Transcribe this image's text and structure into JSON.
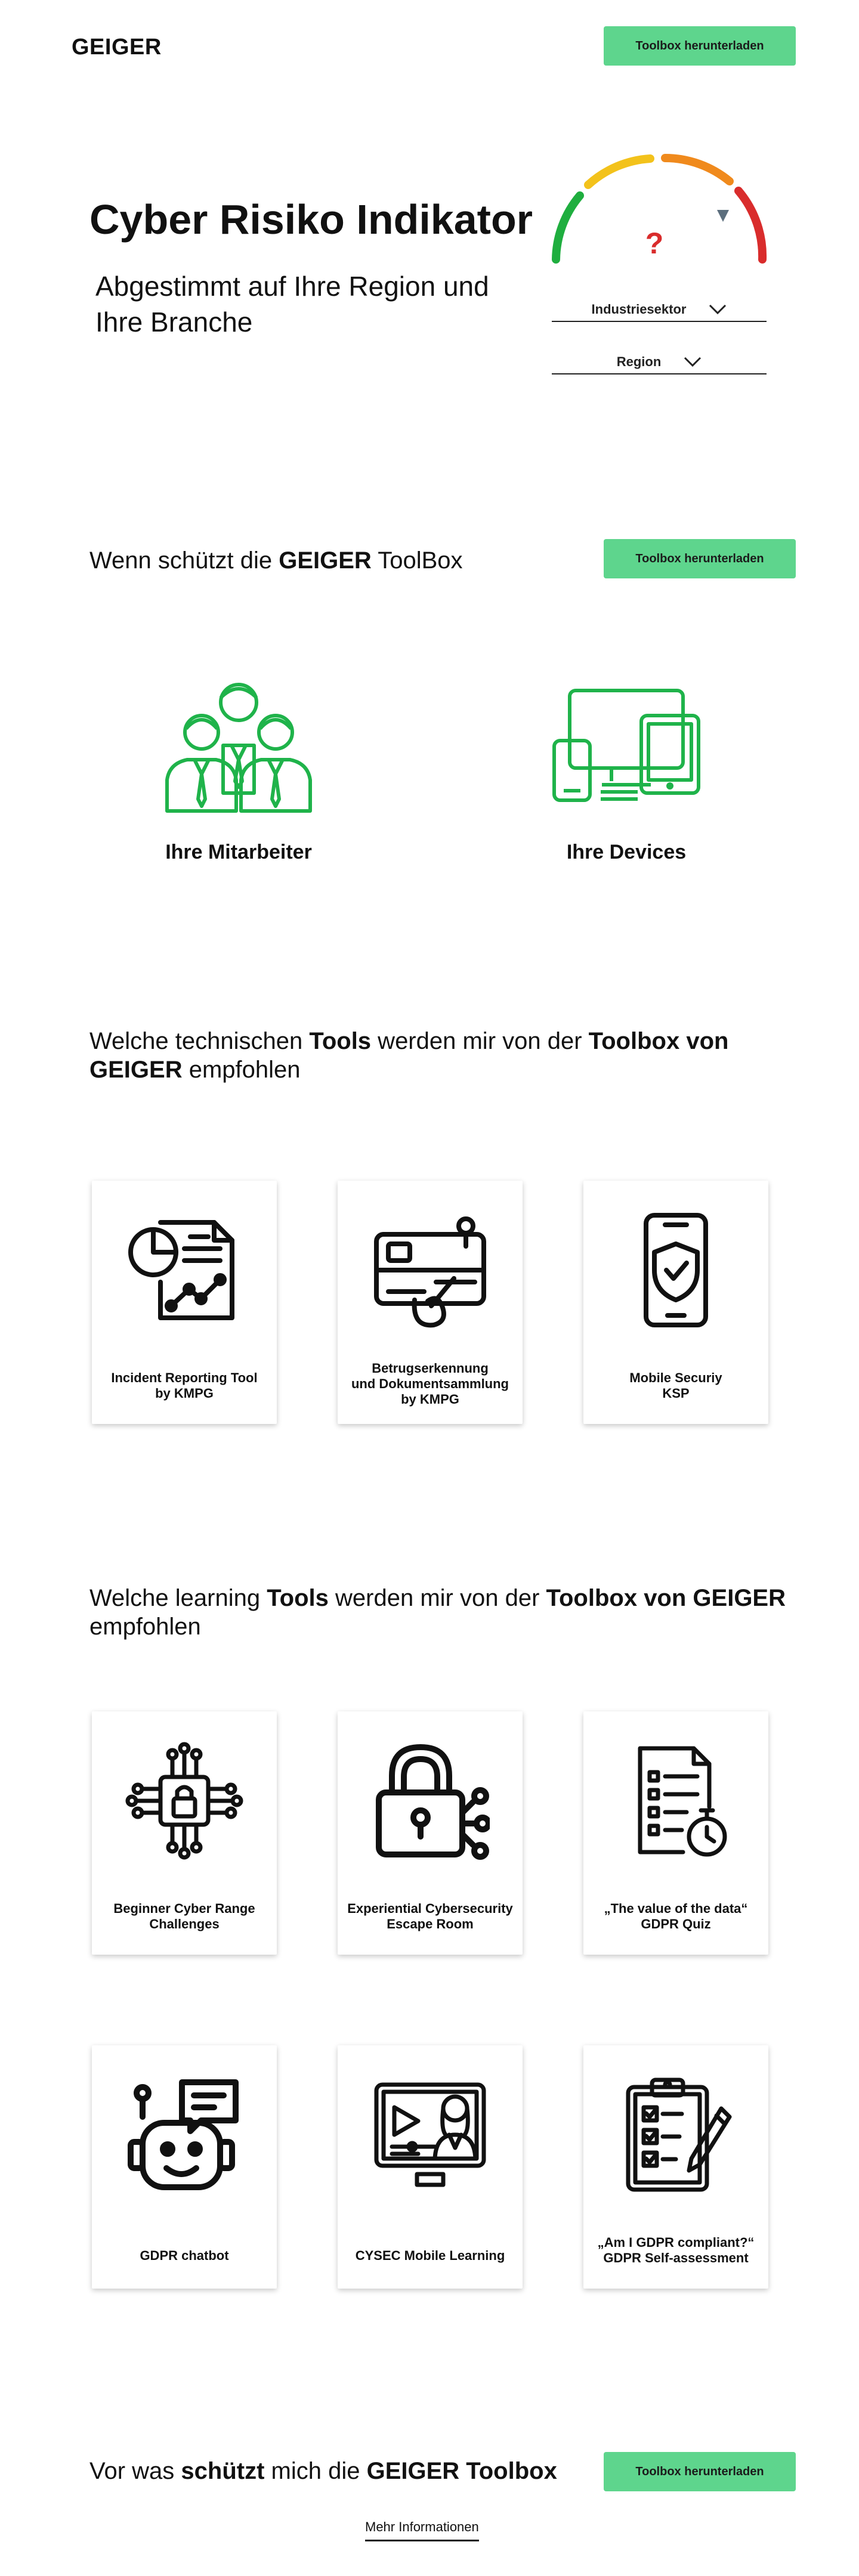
{
  "header": {
    "logo": "GEIGER",
    "cta_label": "Toolbox herunterladen"
  },
  "hero": {
    "title": "Cyber Risiko Indikator",
    "subtitle": "Abgestimmt auf Ihre Region und Ihre Branche",
    "gauge_value": "?",
    "gauge_colors": [
      "#1fae3f",
      "#f3c21b",
      "#f08a1d",
      "#d92c2c"
    ],
    "industry_label": "Industriesektor",
    "region_label": "Region"
  },
  "protects": {
    "text_pre": "Wenn schützt die ",
    "text_bold": "GEIGER",
    "text_post": " ToolBox",
    "cta_label": "Toolbox herunterladen",
    "features": [
      {
        "label": "Ihre Mitarbeiter",
        "icon": "employees-icon"
      },
      {
        "label": "Ihre Devices",
        "icon": "devices-icon"
      }
    ],
    "accent": "#1fb34a"
  },
  "technical": {
    "t1": "Welche technischen ",
    "b1": "Tools",
    "t2": " werden mir von der ",
    "b2": "Toolbox von",
    "b3": "GEIGER",
    "t3": " empfohlen",
    "cards": [
      {
        "label": "Incident Reporting Tool\nby KMPG",
        "icon": "report-chart-icon"
      },
      {
        "label": "Betrugserkennung\nund Dokumentsammlung\nby KMPG",
        "icon": "credit-card-fraud-icon"
      },
      {
        "label": "Mobile Securiy\nKSP",
        "icon": "mobile-shield-icon"
      }
    ]
  },
  "learning": {
    "t1": "Welche learning ",
    "b1": "Tools",
    "t2": " werden mir von der ",
    "b2": "Toolbox von GEIGER",
    "t3": "empfohlen",
    "cards": [
      {
        "label": "Beginner Cyber Range\nChallenges",
        "icon": "circuit-lock-icon"
      },
      {
        "label": "Experiential Cybersecurity\nEscape Room",
        "icon": "padlock-network-icon"
      },
      {
        "label": "„The value of the data“\nGDPR Quiz",
        "icon": "quiz-timer-icon"
      },
      {
        "label": "GDPR chatbot",
        "icon": "chatbot-icon"
      },
      {
        "label": "CYSEC Mobile Learning",
        "icon": "video-learning-icon"
      },
      {
        "label": "„Am I GDPR compliant?“\nGDPR Self-assessment",
        "icon": "checklist-icon"
      }
    ]
  },
  "footer": {
    "t1": "Vor was ",
    "b1": "schützt",
    "t2": " mich die ",
    "b2": "GEIGER Toolbox",
    "cta_label": "Toolbox herunterladen",
    "more_label": "Mehr Informationen"
  }
}
